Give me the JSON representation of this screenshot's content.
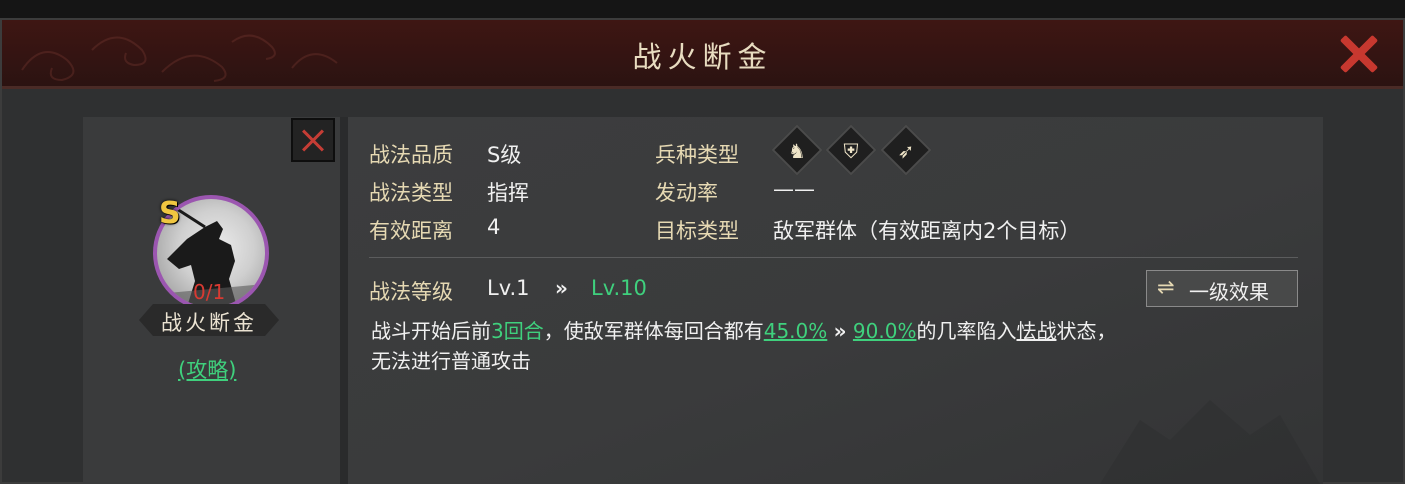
{
  "window": {
    "title": "战火断金"
  },
  "skill": {
    "grade_badge": "S",
    "count": "0/1",
    "name": "战火断金",
    "guide_link": "(攻略)"
  },
  "attributes": [
    {
      "label": "战法品质",
      "value": "S级"
    },
    {
      "label": "战法类型",
      "value": "指挥"
    },
    {
      "label": "有效距离",
      "value": "4"
    },
    {
      "label": "兵种类型",
      "value": ""
    },
    {
      "label": "发动率",
      "value": "——"
    },
    {
      "label": "目标类型",
      "value": "敌军群体（有效距离内2个目标）"
    }
  ],
  "troop_icons": [
    "horse-icon",
    "shield-icon",
    "bow-icon"
  ],
  "level": {
    "label": "战法等级",
    "from": "Lv.1",
    "to": "Lv.10",
    "arrow": "»",
    "effect_button": "一级效果",
    "effect_icon": "swap-icon"
  },
  "description": {
    "p1": "战斗开始后前",
    "rounds": "3回合",
    "p2": "，使敌军群体每回合都有",
    "rate_from": "45.0%",
    "arrow": "»",
    "rate_to": "90.0%",
    "p3": "的几率陷入",
    "status": "怯战",
    "p4": "状态，",
    "line2": "无法进行普通攻击"
  },
  "colors": {
    "accent_green": "#3fd07d",
    "label_gold": "#e6d9b3",
    "close_red": "#c7382f",
    "grade_gold": "#f0c640",
    "portrait_ring": "#9b56b0"
  }
}
